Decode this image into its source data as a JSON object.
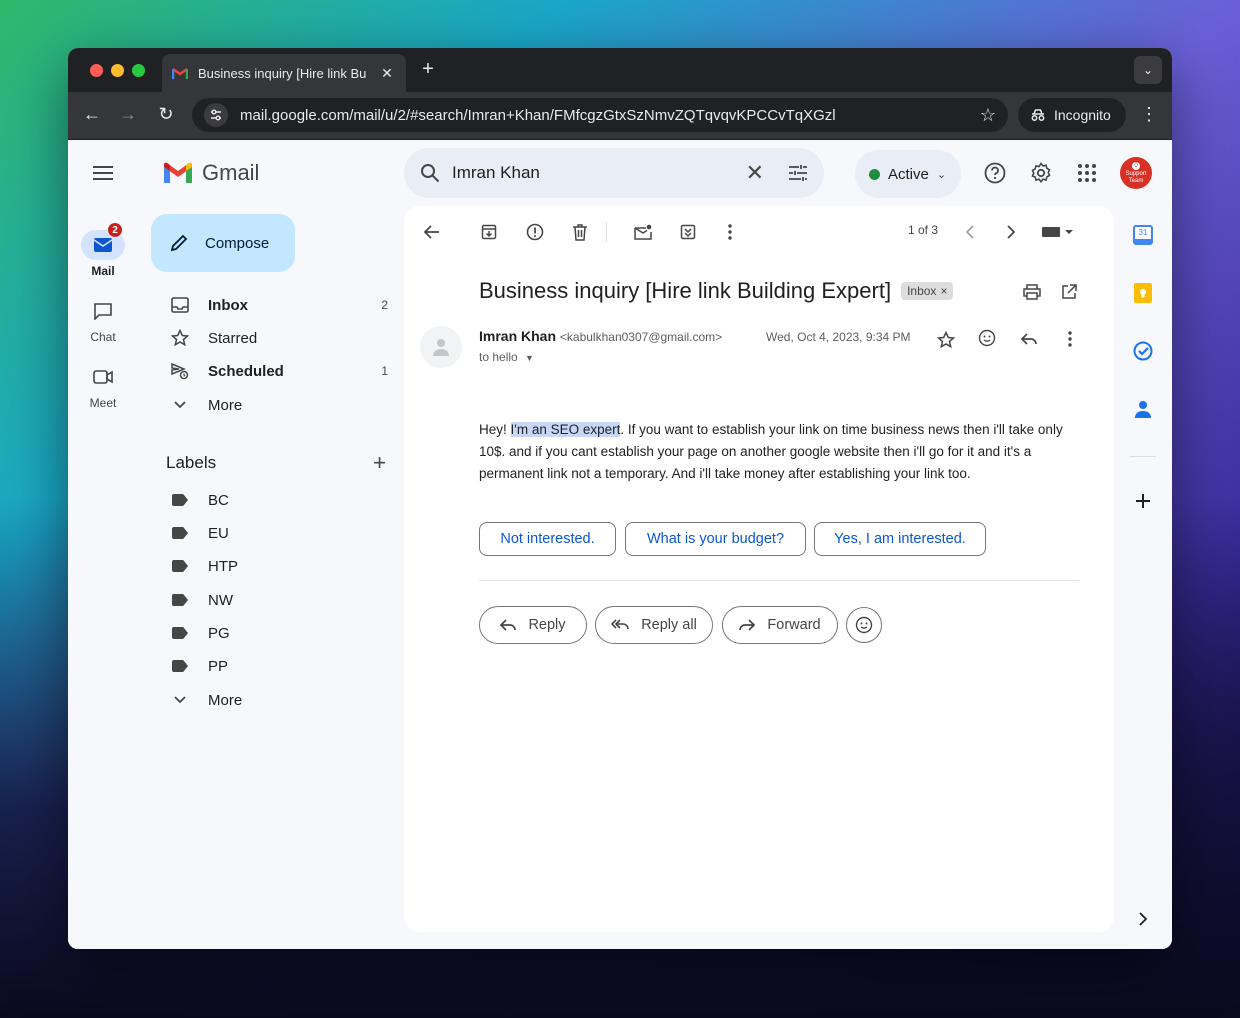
{
  "browser": {
    "tab_title": "Business inquiry [Hire link Bu",
    "url": "mail.google.com/mail/u/2/#search/Imran+Khan/FMfcgzGtxSzNmvZQTqvqvKPCCvTqXGzl",
    "incognito_label": "Incognito"
  },
  "app": {
    "name": "Gmail",
    "search_query": "Imran Khan",
    "status": "Active",
    "avatar_badge": "0",
    "avatar_text_1": "Support",
    "avatar_text_2": "Team"
  },
  "rail": {
    "mail": "Mail",
    "mail_badge": "2",
    "chat": "Chat",
    "meet": "Meet"
  },
  "sidebar": {
    "compose": "Compose",
    "items": [
      {
        "label": "Inbox",
        "count": "2"
      },
      {
        "label": "Starred",
        "count": ""
      },
      {
        "label": "Scheduled",
        "count": "1"
      },
      {
        "label": "More",
        "count": ""
      }
    ],
    "labels_title": "Labels",
    "labels": [
      "BC",
      "EU",
      "HTP",
      "NW",
      "PG",
      "PP"
    ],
    "labels_more": "More"
  },
  "email": {
    "pager": "1 of 3",
    "subject": "Business inquiry [Hire link Building Expert]",
    "inbox_chip": "Inbox",
    "sender_name": "Imran Khan",
    "sender_email": "<kabulkhan0307@gmail.com>",
    "to_line": "to hello",
    "date": "Wed, Oct 4, 2023, 9:34 PM",
    "body_pre": "Hey! ",
    "body_highlight": "I'm an SEO expert",
    "body_post": ". If you want to establish your link on time business news then i'll take only 10$. and if you cant establish your page on another google website then i'll go for it and it's a permanent link not a temporary. And i'll take money after establishing your link too.",
    "smart_replies": [
      "Not interested.",
      "What is your budget?",
      "Yes, I am interested."
    ],
    "reply": "Reply",
    "reply_all": "Reply all",
    "forward": "Forward"
  },
  "side_panel": {
    "calendar_day": "31"
  },
  "colors": {
    "accent_blue": "#0b57d0",
    "compose_bg": "#c2e7ff",
    "badge_red": "#c5221f",
    "active_green": "#1e8e3e"
  }
}
